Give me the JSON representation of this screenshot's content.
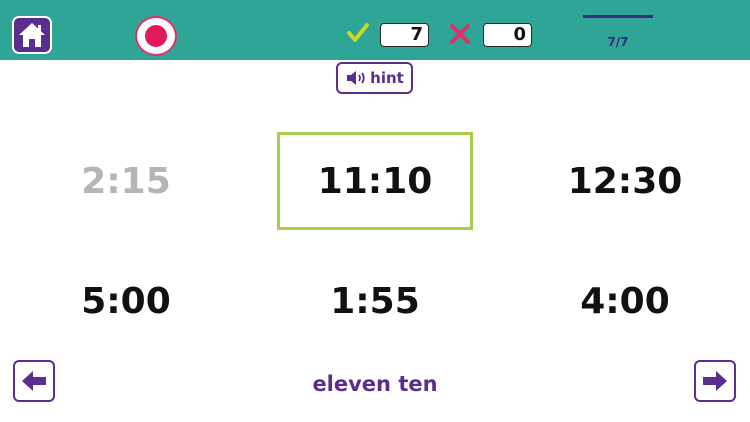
{
  "header": {
    "home_icon": "home-icon",
    "record_icon": "record-icon",
    "correct_icon": "check-icon",
    "wrong_icon": "cross-icon",
    "correct_count": "7",
    "wrong_count": "0",
    "progress_label": "7/7",
    "progress_fraction": 1.0,
    "colors": {
      "bar": "#2ea597",
      "accent": "#5b2d8e",
      "record": "#e01a5c",
      "check": "#c8d928",
      "cross": "#e0306a",
      "selected_border": "#a5cf4c"
    }
  },
  "hint": {
    "label": "hint",
    "icon": "speaker-icon"
  },
  "options": [
    {
      "time": "2:15",
      "state": "dimmed"
    },
    {
      "time": "11:10",
      "state": "selected"
    },
    {
      "time": "12:30",
      "state": "normal"
    },
    {
      "time": "5:00",
      "state": "normal"
    },
    {
      "time": "1:55",
      "state": "normal"
    },
    {
      "time": "4:00",
      "state": "normal"
    }
  ],
  "footer": {
    "prompt": "eleven ten",
    "prev_icon": "arrow-left-icon",
    "next_icon": "arrow-right-icon"
  }
}
